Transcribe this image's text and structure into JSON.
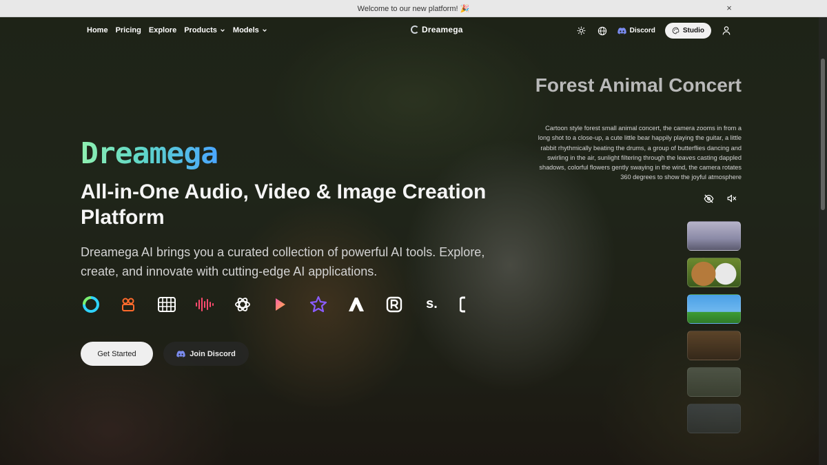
{
  "announcement": {
    "text": "Welcome to our new platform! 🎉",
    "close_label": "×"
  },
  "nav": {
    "items": [
      {
        "label": "Home"
      },
      {
        "label": "Pricing"
      },
      {
        "label": "Explore"
      },
      {
        "label": "Products",
        "dropdown": true
      },
      {
        "label": "Models",
        "dropdown": true
      }
    ],
    "logo_text": "Dreamega",
    "discord_label": "Discord",
    "studio_label": "Studio"
  },
  "hero": {
    "brand": "Dreamega",
    "headline": "All-in-One Audio, Video & Image Creation Platform",
    "subtitle": "Dreamega AI brings you a curated collection of powerful AI tools. Explore, create, and innovate with cutting-edge AI applications.",
    "tools": [
      {
        "name": "ring-logo-icon",
        "text": ""
      },
      {
        "name": "camera-logo-icon",
        "text": ""
      },
      {
        "name": "grid-logo-icon",
        "text": ""
      },
      {
        "name": "waveform-logo-icon",
        "text": ""
      },
      {
        "name": "openai-logo-icon",
        "text": ""
      },
      {
        "name": "play-logo-icon",
        "text": ""
      },
      {
        "name": "star-logo-icon",
        "text": ""
      },
      {
        "name": "a-logo-icon",
        "text": ""
      },
      {
        "name": "r-logo-icon",
        "text": ""
      },
      {
        "name": "s-logo-icon",
        "text": "s."
      },
      {
        "name": "partial-logo-icon",
        "text": ""
      }
    ],
    "get_started_label": "Get Started",
    "join_discord_label": "Join Discord"
  },
  "showcase": {
    "title": "Forest Animal Concert",
    "description": "Cartoon style forest small animal concert, the camera zooms in from a long shot to a close-up, a cute little bear happily playing the guitar, a little rabbit rhythmically beating the drums, a group of butterflies dancing and swirling in the air, sunlight filtering through the leaves casting dappled shadows, colorful flowers gently swaying in the wind, the camera rotates 360 degrees to show the joyful atmosphere",
    "thumbnail_count": 6
  },
  "colors": {
    "brand_gradient_start": "#8ff0b0",
    "brand_gradient_end": "#4aa6ff",
    "discord": "#7289da"
  }
}
